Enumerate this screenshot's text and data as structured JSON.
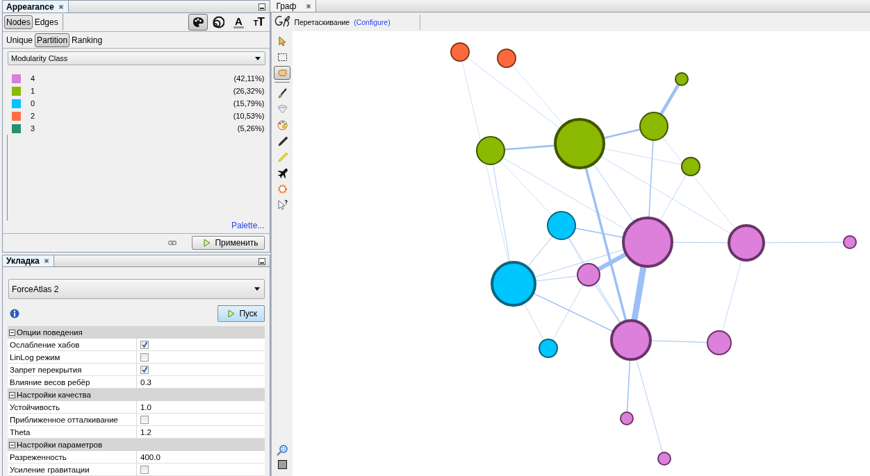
{
  "appearance": {
    "title": "Appearance",
    "element_tabs": [
      {
        "label": "Nodes",
        "selected": true
      },
      {
        "label": "Edges",
        "selected": false
      }
    ],
    "attribute_buttons": [
      {
        "kind": "color",
        "selected": true
      },
      {
        "kind": "size",
        "selected": false
      },
      {
        "kind": "label-color",
        "glyph": "A",
        "selected": false
      },
      {
        "kind": "label-size",
        "glyph": "TT",
        "selected": false
      }
    ],
    "mode_tabs": [
      {
        "label": "Unique",
        "selected": false
      },
      {
        "label": "Partition",
        "selected": true
      },
      {
        "label": "Ranking",
        "selected": false
      }
    ],
    "attribute_dropdown": "Modularity Class",
    "partitions": [
      {
        "label": "4",
        "share": "(42,11%)",
        "color": "#da80da"
      },
      {
        "label": "1",
        "share": "(26,32%)",
        "color": "#8cb800"
      },
      {
        "label": "0",
        "share": "(15,79%)",
        "color": "#00c3ff"
      },
      {
        "label": "2",
        "share": "(10,53%)",
        "color": "#ff6f45"
      },
      {
        "label": "3",
        "share": "(5,26%)",
        "color": "#24926c"
      }
    ],
    "palette_link": "Palette...",
    "apply_button": "Применить"
  },
  "layout": {
    "title": "Укладка",
    "algorithm_dropdown": "ForceAtlas 2",
    "run_button": "Пуск",
    "sections": [
      {
        "title": "Опции поведения",
        "expanded": true,
        "rows": [
          {
            "label": "Ослабление хабов",
            "kind": "checkbox",
            "checked": true
          },
          {
            "label": "LinLog режим",
            "kind": "checkbox",
            "checked": false
          },
          {
            "label": "Запрет перекрытия",
            "kind": "checkbox",
            "checked": true
          },
          {
            "label": "Влияние весов ребёр",
            "kind": "value",
            "value": "0.3"
          }
        ]
      },
      {
        "title": "Настройки качества",
        "expanded": true,
        "rows": [
          {
            "label": "Устойчивость",
            "kind": "value",
            "value": "1.0"
          },
          {
            "label": "Приближенное отталкивание",
            "kind": "checkbox",
            "checked": false
          },
          {
            "label": "Theta",
            "kind": "value",
            "value": "1.2"
          }
        ]
      },
      {
        "title": "Настройки параметров",
        "expanded": true,
        "rows": [
          {
            "label": "Разреженность",
            "kind": "value",
            "value": "400.0"
          },
          {
            "label": "Усиление гравитации",
            "kind": "checkbox",
            "checked": false
          }
        ]
      }
    ]
  },
  "graph": {
    "title": "Граф",
    "tool_name": "Перетаскивание",
    "configure_link": "(Configure)",
    "tools": [
      {
        "kind": "pointer",
        "selected": false
      },
      {
        "kind": "rectangle-select",
        "selected": false
      },
      {
        "kind": "drag",
        "selected": true
      },
      {
        "kind": "brush",
        "selected": false
      },
      {
        "kind": "diamond",
        "selected": false
      },
      {
        "kind": "painter",
        "selected": false
      },
      {
        "kind": "pencil",
        "selected": false
      },
      {
        "kind": "highlighter",
        "selected": false
      },
      {
        "kind": "airplane",
        "selected": false
      },
      {
        "kind": "sun",
        "selected": false
      },
      {
        "kind": "help-pointer",
        "selected": false
      }
    ]
  }
}
